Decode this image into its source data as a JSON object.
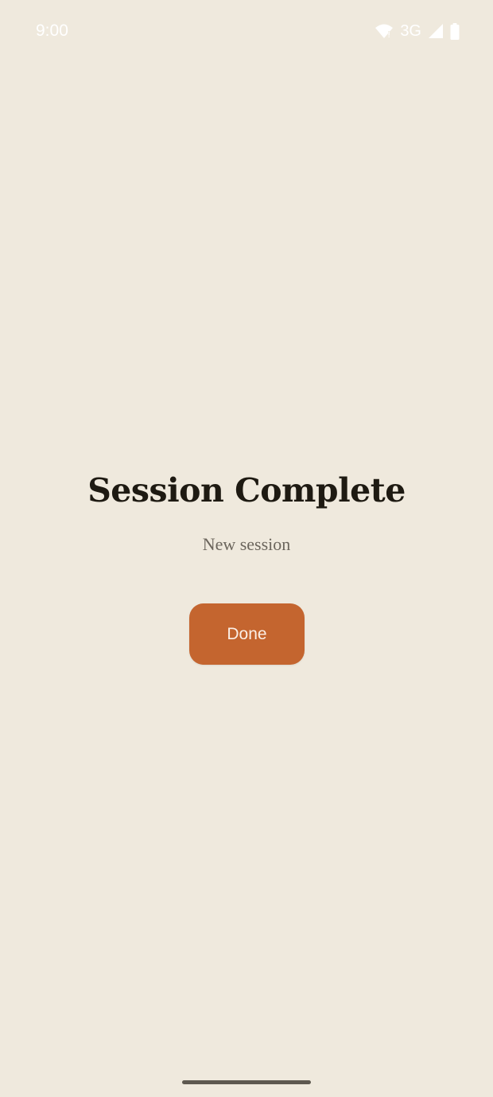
{
  "status_bar": {
    "time": "9:00",
    "network": "3G",
    "icons": [
      "wifi-icon",
      "cell-signal-icon",
      "battery-icon"
    ]
  },
  "main": {
    "title": "Session Complete",
    "subtitle": "New session",
    "done_label": "Done"
  },
  "colors": {
    "background": "#EFE9DD",
    "accent": "#C4652F",
    "title_text": "#1E1A12",
    "subtitle_text": "#6B655C"
  }
}
